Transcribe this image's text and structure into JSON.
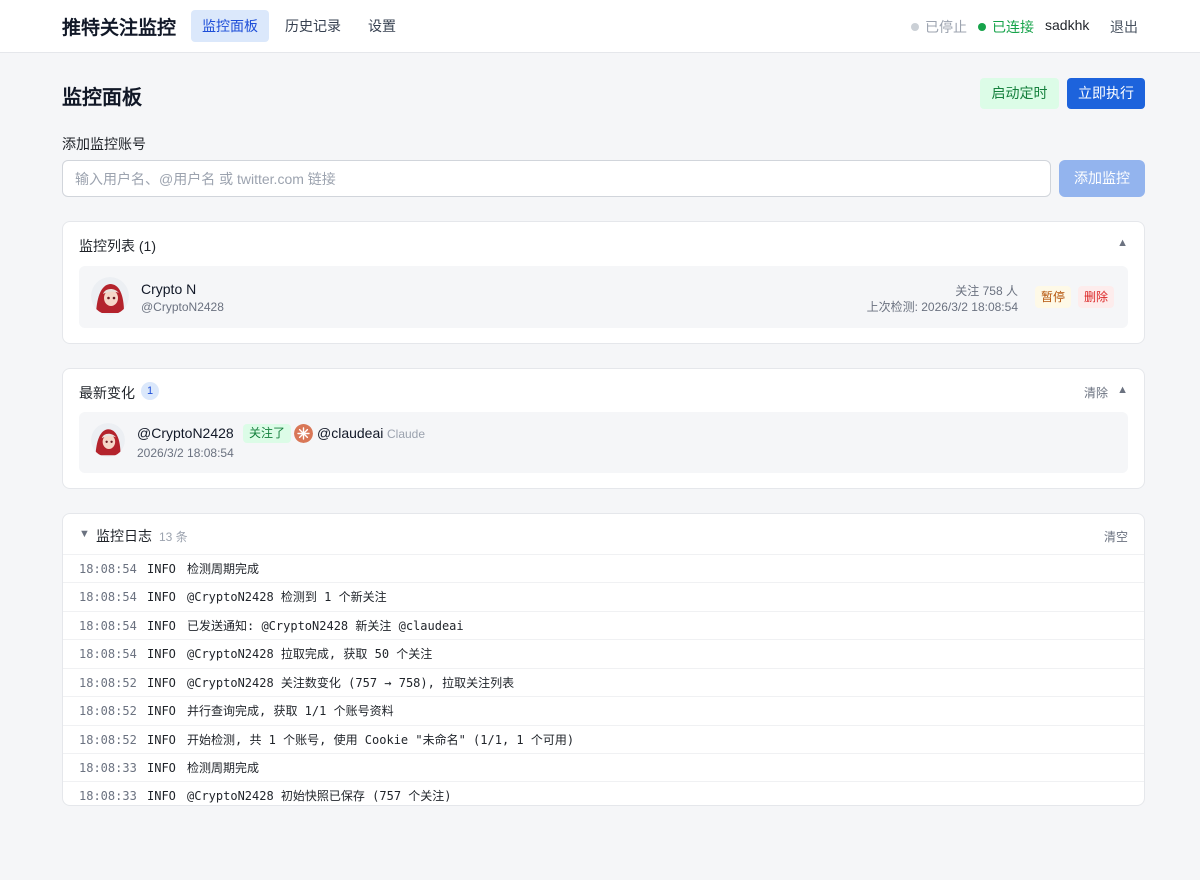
{
  "nav": {
    "brand": "推特关注监控",
    "tabs": [
      {
        "label": "监控面板",
        "active": true
      },
      {
        "label": "历史记录",
        "active": false
      },
      {
        "label": "设置",
        "active": false
      }
    ],
    "status_stopped": "已停止",
    "status_connected": "已连接",
    "username": "sadkhk",
    "logout": "退出"
  },
  "header": {
    "title": "监控面板",
    "schedule_button": "启动定时",
    "run_button": "立即执行"
  },
  "add": {
    "label": "添加监控账号",
    "placeholder": "输入用户名、@用户名 或 twitter.com 链接",
    "value": "",
    "button": "添加监控"
  },
  "monitor_list": {
    "title": "监控列表 (1)",
    "collapse_icon": "▲",
    "items": [
      {
        "name": "Crypto N",
        "handle": "@CryptoN2428",
        "following": "关注 758 人",
        "last_check": "上次检测: 2026/3/2 18:08:54",
        "pause_label": "暂停",
        "delete_label": "删除"
      }
    ]
  },
  "changes": {
    "title": "最新变化",
    "count": "1",
    "clear_label": "清除",
    "collapse_icon": "▲",
    "items": [
      {
        "actor": "@CryptoN2428",
        "action": "关注了",
        "target": "@claudeai",
        "target_name": "Claude",
        "time": "2026/3/2 18:08:54"
      }
    ]
  },
  "log": {
    "toggle_icon": "▼",
    "title": "监控日志",
    "count": "13 条",
    "clear_label": "清空",
    "entries": [
      {
        "time": "18:08:54",
        "level": "INFO",
        "msg": "检测周期完成"
      },
      {
        "time": "18:08:54",
        "level": "INFO",
        "msg": "@CryptoN2428 检测到 1 个新关注"
      },
      {
        "time": "18:08:54",
        "level": "INFO",
        "msg": "已发送通知: @CryptoN2428 新关注 @claudeai"
      },
      {
        "time": "18:08:54",
        "level": "INFO",
        "msg": "@CryptoN2428 拉取完成, 获取 50 个关注"
      },
      {
        "time": "18:08:52",
        "level": "INFO",
        "msg": "@CryptoN2428 关注数变化 (757 → 758), 拉取关注列表"
      },
      {
        "time": "18:08:52",
        "level": "INFO",
        "msg": "并行查询完成, 获取 1/1 个账号资料"
      },
      {
        "time": "18:08:52",
        "level": "INFO",
        "msg": "开始检测, 共 1 个账号, 使用 Cookie \"未命名\" (1/1, 1 个可用)"
      },
      {
        "time": "18:08:33",
        "level": "INFO",
        "msg": "检测周期完成"
      },
      {
        "time": "18:08:33",
        "level": "INFO",
        "msg": "@CryptoN2428 初始快照已保存 (757 个关注)"
      }
    ]
  },
  "colors": {
    "accent": "#1d63dc",
    "connected": "#16a34a",
    "stopped": "#cbd0d6"
  }
}
